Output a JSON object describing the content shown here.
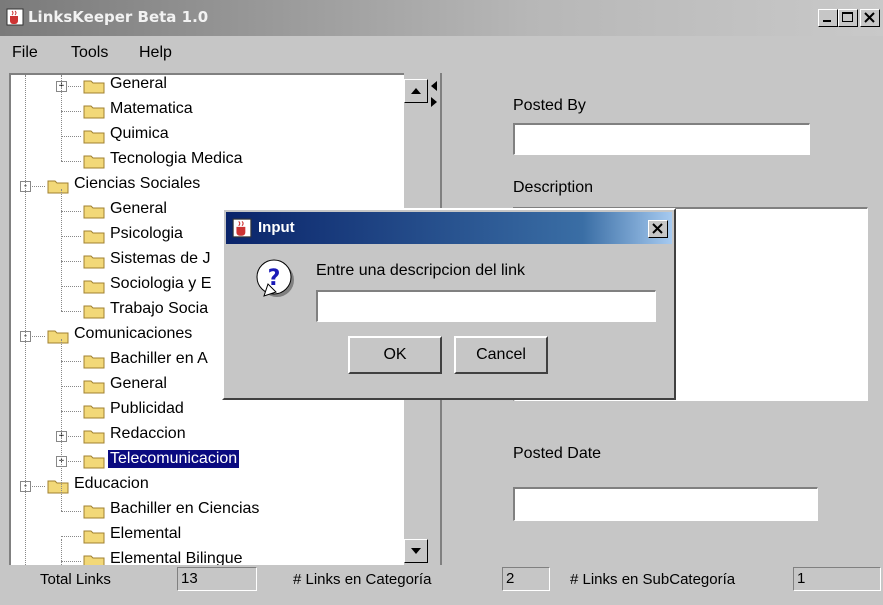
{
  "window": {
    "title": "LinksKeeper Beta 1.0",
    "icon": "java-cup-icon"
  },
  "menu": [
    "File",
    "Tools",
    "Help"
  ],
  "tree": [
    {
      "label": "General",
      "level": 1,
      "expander": "+"
    },
    {
      "label": "Matematica",
      "level": 1
    },
    {
      "label": "Quimica",
      "level": 1
    },
    {
      "label": "Tecnologia Medica",
      "level": 1
    },
    {
      "label": "Ciencias Sociales",
      "level": 0,
      "expander": "-"
    },
    {
      "label": "General",
      "level": 1
    },
    {
      "label": "Psicologia",
      "level": 1
    },
    {
      "label": "Sistemas de J",
      "level": 1
    },
    {
      "label": "Sociologia y E",
      "level": 1
    },
    {
      "label": "Trabajo Socia",
      "level": 1
    },
    {
      "label": "Comunicaciones",
      "level": 0,
      "expander": "-"
    },
    {
      "label": "Bachiller en A",
      "level": 1
    },
    {
      "label": "General",
      "level": 1
    },
    {
      "label": "Publicidad",
      "level": 1
    },
    {
      "label": "Redaccion",
      "level": 1,
      "expander": "+"
    },
    {
      "label": "Telecomunicacion",
      "level": 1,
      "expander": "+",
      "selected": true
    },
    {
      "label": "Educacion",
      "level": 0,
      "expander": "-"
    },
    {
      "label": "Bachiller en Ciencias",
      "level": 1
    },
    {
      "label": "Elemental",
      "level": 1
    },
    {
      "label": "Elemental Bilingue",
      "level": 1
    }
  ],
  "details": {
    "posted_by_label": "Posted By",
    "posted_by_value": "",
    "description_label": "Description",
    "posted_date_label": "Posted Date",
    "posted_date_value": ""
  },
  "status": {
    "total_links_label": "Total Links",
    "total_links_value": "13",
    "cat_label": "# Links en Categoría",
    "cat_value": "2",
    "subcat_label": "# Links en SubCategoría",
    "subcat_value": "1"
  },
  "dialog": {
    "title": "Input",
    "message": "Entre una descripcion del link",
    "input_value": "",
    "ok_label": "OK",
    "cancel_label": "Cancel",
    "icon": "question-icon"
  },
  "colors": {
    "selection": "#0a0a80",
    "folder": "#f2d878",
    "dialog_title": "#0a246a"
  }
}
